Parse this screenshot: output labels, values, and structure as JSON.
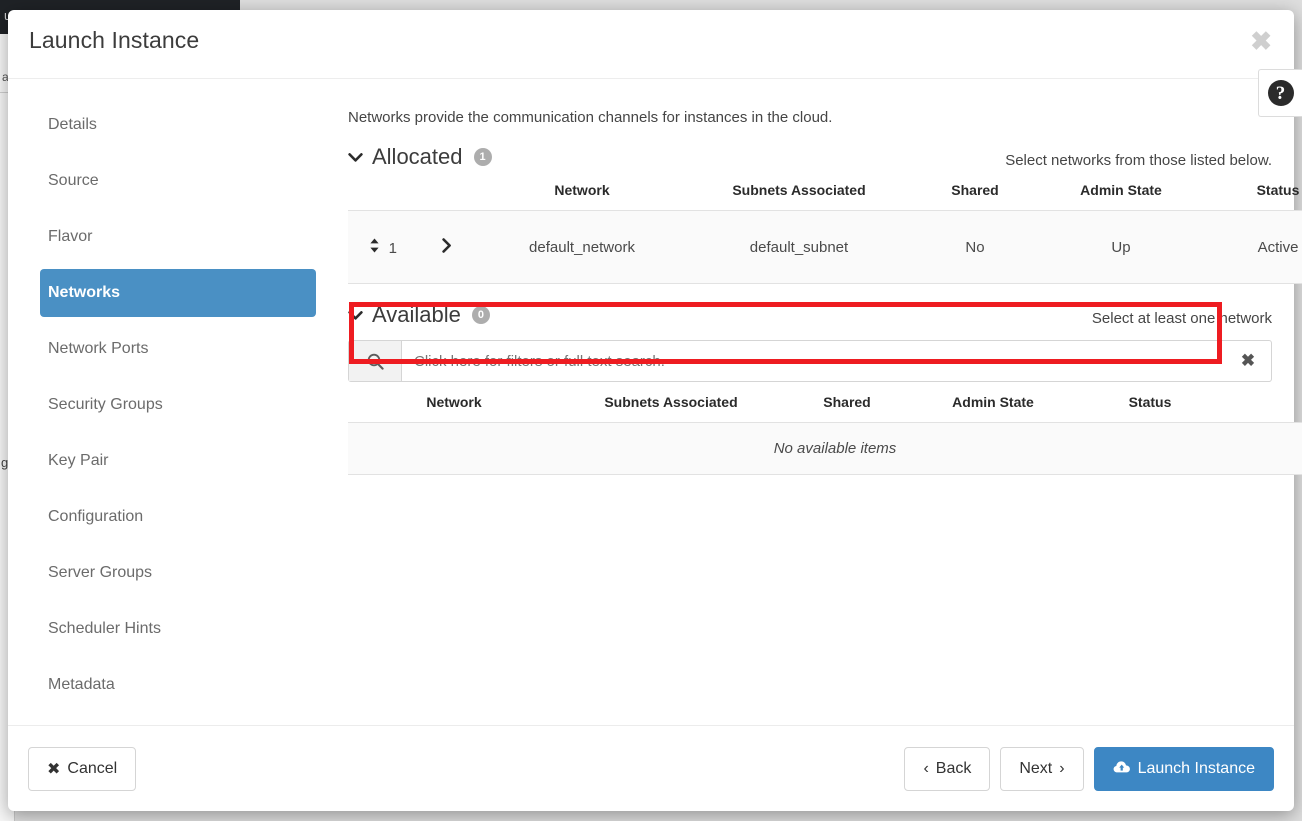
{
  "backdrop": {
    "navbar_text": "u",
    "breadcrumb_fragment": "a",
    "body_fragment": "g"
  },
  "modal": {
    "title": "Launch Instance",
    "close_label": "✖",
    "help_label": "?"
  },
  "sidebar": {
    "items": [
      {
        "label": "Details",
        "active": false
      },
      {
        "label": "Source",
        "active": false
      },
      {
        "label": "Flavor",
        "active": false
      },
      {
        "label": "Networks",
        "active": true
      },
      {
        "label": "Network Ports",
        "active": false
      },
      {
        "label": "Security Groups",
        "active": false
      },
      {
        "label": "Key Pair",
        "active": false
      },
      {
        "label": "Configuration",
        "active": false
      },
      {
        "label": "Server Groups",
        "active": false
      },
      {
        "label": "Scheduler Hints",
        "active": false
      },
      {
        "label": "Metadata",
        "active": false
      }
    ]
  },
  "main": {
    "intro": "Networks provide the communication channels for instances in the cloud.",
    "allocated": {
      "chevron": "⌄",
      "title": "Allocated",
      "count": "1",
      "hint": "Select networks from those listed below.",
      "columns": [
        "Network",
        "Subnets Associated",
        "Shared",
        "Admin State",
        "Status"
      ],
      "rows": [
        {
          "order": "1",
          "sort_handle": "↕",
          "expand": "❯",
          "network": "default_network",
          "subnets": "default_subnet",
          "shared": "No",
          "admin_state": "Up",
          "status": "Active",
          "action_icon": "↓"
        }
      ]
    },
    "available": {
      "chevron": "⌄",
      "title": "Available",
      "count": "0",
      "hint": "Select at least one network",
      "search": {
        "placeholder": "Click here for filters or full text search.",
        "value": "",
        "icon": "search-icon",
        "clear_label": "✖"
      },
      "columns": [
        "Network",
        "Subnets Associated",
        "Shared",
        "Admin State",
        "Status"
      ],
      "empty_message": "No available items"
    }
  },
  "footer": {
    "cancel_label": "Cancel",
    "cancel_icon": "✖",
    "back_label": "Back",
    "back_icon": "‹",
    "next_label": "Next",
    "next_icon": "›",
    "launch_label": "Launch Instance",
    "launch_icon": "☁"
  },
  "colors": {
    "accent": "#3d87c4",
    "nav_active": "#4a90c4",
    "highlight": "#ee1c21",
    "badge": "#adadad"
  }
}
